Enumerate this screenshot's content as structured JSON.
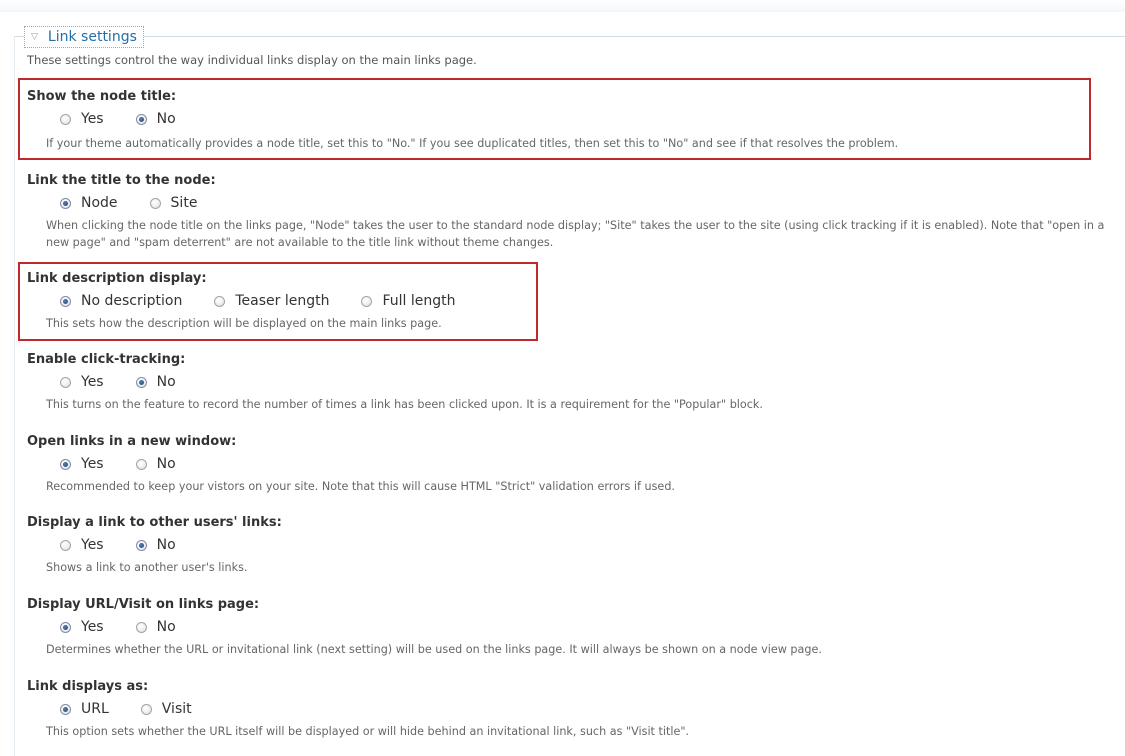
{
  "fieldset": {
    "toggle_icon": "triangle-down-icon",
    "legend": "Link settings",
    "intro": "These settings control the way individual links display on the main links page."
  },
  "settings": [
    {
      "label": "Show the node title:",
      "options": [
        "Yes",
        "No"
      ],
      "selected": "No",
      "description": "If your theme automatically provides a node title, set this to \"No.\" If you see duplicated titles, then set this to \"No\" and see if that resolves the problem.",
      "highlighted": true
    },
    {
      "label": "Link the title to the node:",
      "options": [
        "Node",
        "Site"
      ],
      "selected": "Node",
      "description": "When clicking the node title on the links page, \"Node\" takes the user to the standard node display; \"Site\" takes the user to the site (using click tracking if it is enabled). Note that \"open in a new page\" and \"spam deterrent\" are not available to the title link without theme changes.",
      "highlighted": false
    },
    {
      "label": "Link description display:",
      "options": [
        "No description",
        "Teaser length",
        "Full length"
      ],
      "selected": "No description",
      "description": "This sets how the description will be displayed on the main links page.",
      "highlighted": true
    },
    {
      "label": "Enable click-tracking:",
      "options": [
        "Yes",
        "No"
      ],
      "selected": "No",
      "description": "This turns on the feature to record the number of times a link has been clicked upon. It is a requirement for the \"Popular\" block.",
      "highlighted": false
    },
    {
      "label": "Open links in a new window:",
      "options": [
        "Yes",
        "No"
      ],
      "selected": "Yes",
      "description": "Recommended to keep your vistors on your site. Note that this will cause HTML \"Strict\" validation errors if used.",
      "highlighted": false
    },
    {
      "label": "Display a link to other users' links:",
      "options": [
        "Yes",
        "No"
      ],
      "selected": "No",
      "description": "Shows a link to another user's links.",
      "highlighted": false
    },
    {
      "label": "Display URL/Visit on links page:",
      "options": [
        "Yes",
        "No"
      ],
      "selected": "Yes",
      "description": "Determines whether the URL or invitational link (next setting) will be used on the links page. It will always be shown on a node view page.",
      "highlighted": false
    },
    {
      "label": "Link displays as:",
      "options": [
        "URL",
        "Visit"
      ],
      "selected": "URL",
      "description": "This option sets whether the URL itself will be displayed or will hide behind an invitational link, such as \"Visit title\".",
      "highlighted": false
    }
  ],
  "colors": {
    "highlight_border": "#c0282e",
    "legend_link": "#1f6fa8"
  }
}
